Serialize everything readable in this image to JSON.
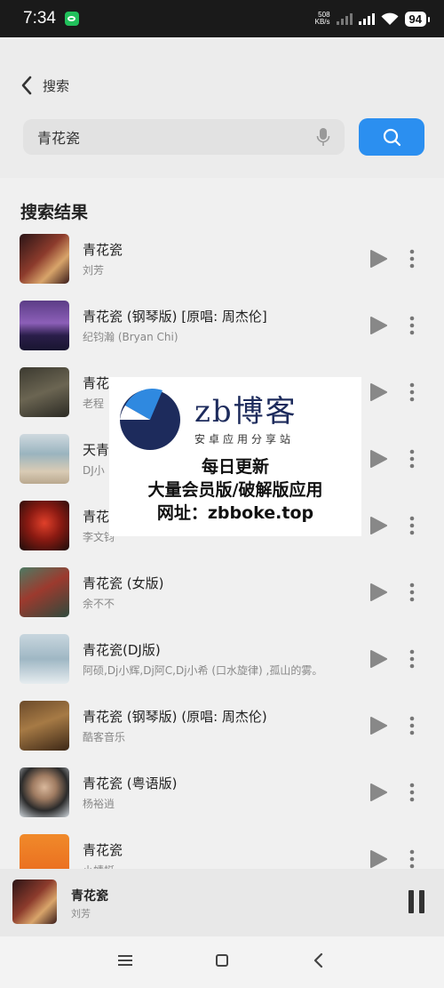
{
  "status_bar": {
    "time": "7:34",
    "net_speed_value": "508",
    "net_speed_unit": "KB/s",
    "battery": "94"
  },
  "header": {
    "back_label": "搜索",
    "search_value": "青花瓷"
  },
  "section_title": "搜索结果",
  "results": [
    {
      "title": "青花瓷",
      "artist": "刘芳"
    },
    {
      "title": "青花瓷 (钢琴版) [原唱: 周杰伦]",
      "artist": "纪钧瀚 (Bryan Chi)"
    },
    {
      "title": "青花",
      "artist": "老程"
    },
    {
      "title": "天青",
      "artist": "DJ小"
    },
    {
      "title": "青花",
      "artist": "李文钧"
    },
    {
      "title": "青花瓷 (女版)",
      "artist": "余不不"
    },
    {
      "title": "青花瓷(DJ版)",
      "artist": "阿硕,Dj小辉,Dj阿C,Dj小希 (口水旋律) ,孤山的雾。"
    },
    {
      "title": "青花瓷 (钢琴版) (原唱: 周杰伦)",
      "artist": "酷客音乐"
    },
    {
      "title": "青花瓷 (粤语版)",
      "artist": "杨裕逍"
    },
    {
      "title": "青花瓷",
      "artist": "小蜻蜓"
    }
  ],
  "watermark": {
    "brand": "zb博客",
    "tagline": "安卓应用分享站",
    "line1": "每日更新",
    "line2": "大量会员版/破解版应用",
    "line3": "网址：zbboke.top"
  },
  "mini_player": {
    "title": "青花瓷",
    "artist": "刘芳"
  },
  "colors": {
    "accent": "#2b8ff0",
    "status_bar": "#1a1a1a",
    "background": "#f0f0f0"
  },
  "icons": [
    "wechat-icon",
    "signal-icon",
    "wifi-icon",
    "back-icon",
    "mic-icon",
    "search-icon",
    "play-icon",
    "more-icon",
    "pause-icon",
    "menu-icon",
    "home-icon",
    "nav-back-icon"
  ]
}
